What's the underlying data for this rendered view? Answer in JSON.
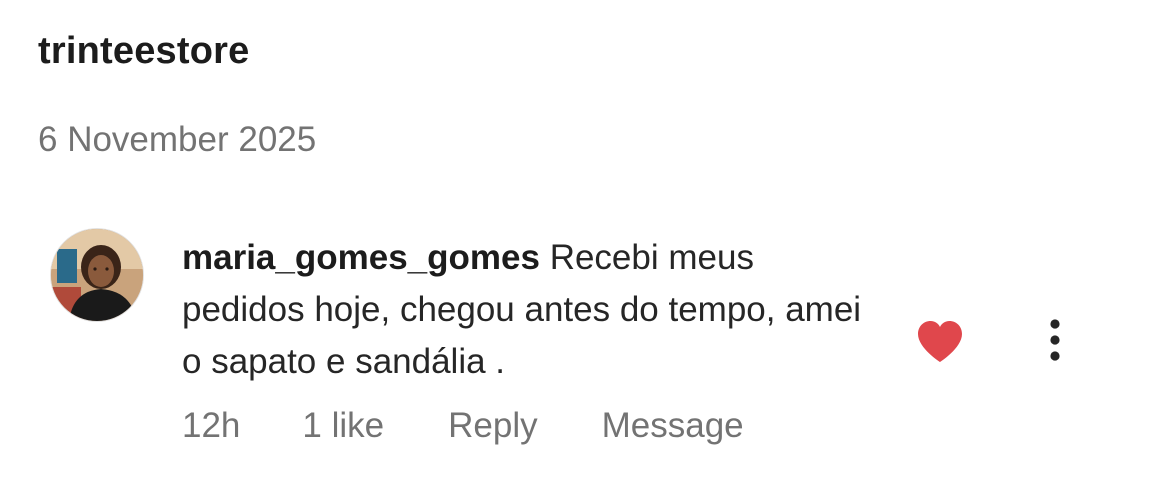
{
  "header": {
    "account_name": "trinteestore",
    "date": "6 November 2025"
  },
  "comment": {
    "avatar_icon": "profile-photo",
    "username": "maria_gomes_gomes",
    "text": "Recebi meus pedidos hoje, chegou antes do tempo, amei o sapato e sandália .",
    "liked": true,
    "like_color": "#e0474c",
    "like_icon": "heart-icon",
    "more_icon": "more-vertical-icon",
    "actions": {
      "time": "12h",
      "likes": "1 like",
      "reply": "Reply",
      "message": "Message"
    }
  }
}
